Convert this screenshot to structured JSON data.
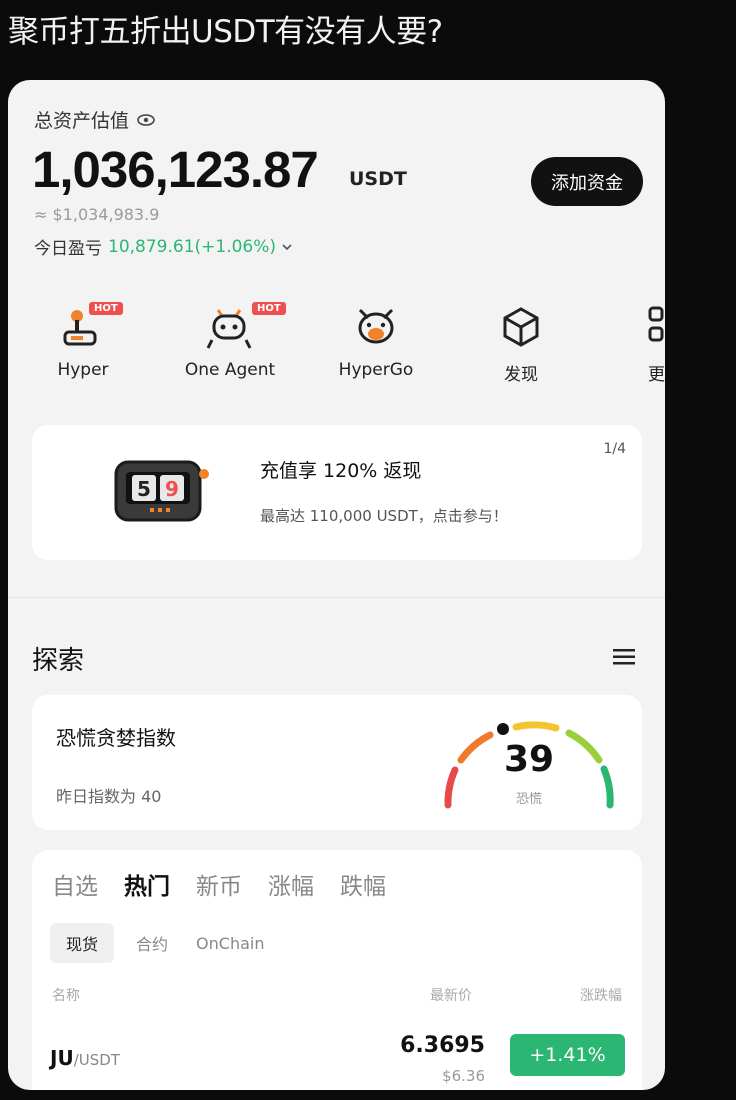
{
  "post": {
    "title": "聚币打五折出USDT有没有人要?"
  },
  "account": {
    "assets_label": "总资产估值",
    "balance": "1,036,123.87",
    "balance_unit": "USDT",
    "usd_estimate": "≈ $1,034,983.9",
    "pnl_label": "今日盈亏",
    "pnl_value": "10,879.61(+1.06%)",
    "add_funds_label": "添加资金"
  },
  "shortcuts": [
    {
      "label": "Hyper",
      "icon": "joystick-icon",
      "badge": "HOT"
    },
    {
      "label": "One Agent",
      "icon": "robot-icon",
      "badge": "HOT"
    },
    {
      "label": "HyperGo",
      "icon": "shiba-icon"
    },
    {
      "label": "发现",
      "icon": "cube-icon"
    },
    {
      "label": "更",
      "icon": "grid-icon"
    }
  ],
  "banner": {
    "title": "充值享 120% 返现",
    "subtitle": "最高达 110,000 USDT，点击参与！",
    "page": "1/4",
    "slot_digits": "59"
  },
  "explore": {
    "title": "探索",
    "fear_greed": {
      "title": "恐慌贪婪指数",
      "yesterday": "昨日指数为 40",
      "value": "39",
      "level": "恐慌"
    }
  },
  "markets": {
    "tabs": [
      "自选",
      "热门",
      "新币",
      "涨幅",
      "跌幅"
    ],
    "active_tab": "热门",
    "subtabs": [
      "现货",
      "合约",
      "OnChain"
    ],
    "columns": {
      "name": "名称",
      "price": "最新价",
      "change": "涨跌幅"
    },
    "rows": [
      {
        "base": "JU",
        "quote": "/USDT",
        "price": "6.3695",
        "price_usd": "$6.36",
        "change": "+1.41%"
      }
    ]
  },
  "colors": {
    "up": "#2bb673",
    "hot": "#ef4f4f",
    "button": "#111111"
  }
}
